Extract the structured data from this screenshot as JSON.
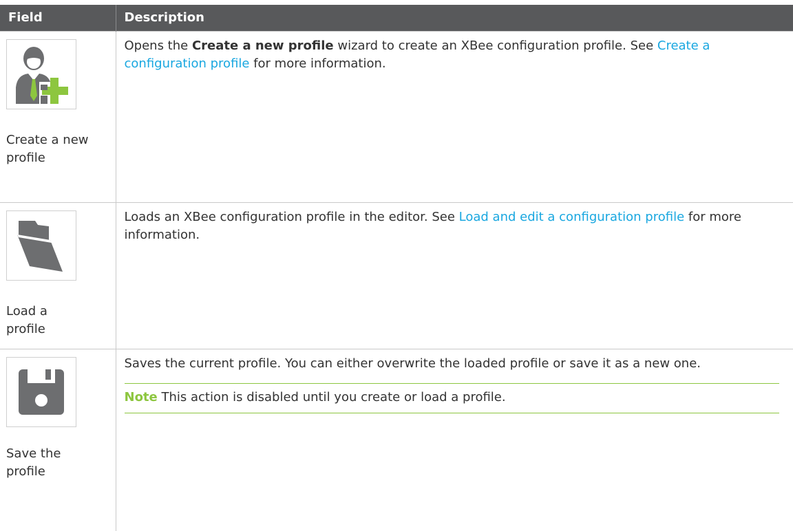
{
  "table": {
    "headers": [
      "Field",
      "Description"
    ],
    "rows": [
      {
        "icon": "create-profile-icon",
        "field": "Create a new profile",
        "desc_before": "Opens the ",
        "desc_bold": "Create a new profile",
        "desc_middle": " wizard to create an XBee configuration profile. See ",
        "desc_link": "Create a configuration profile",
        "desc_after": " for more information."
      },
      {
        "icon": "folder-icon",
        "field": "Load a profile",
        "desc_before": "Loads an XBee configuration profile in the editor. See ",
        "desc_link": "Load and edit a configuration profile",
        "desc_after": " for more information."
      },
      {
        "icon": "floppy-disk-icon",
        "field": "Save the profile",
        "desc": "Saves the current profile. You can either overwrite the loaded profile or save it as a new one.",
        "note_label": "Note",
        "note_text": " This action is disabled until you create or load a profile."
      }
    ]
  },
  "colors": {
    "header_bg": "#58595b",
    "link": "#19a7e0",
    "note_accent": "#8dc63f",
    "icon_gray": "#6d6e70",
    "icon_green": "#8dc63f"
  }
}
